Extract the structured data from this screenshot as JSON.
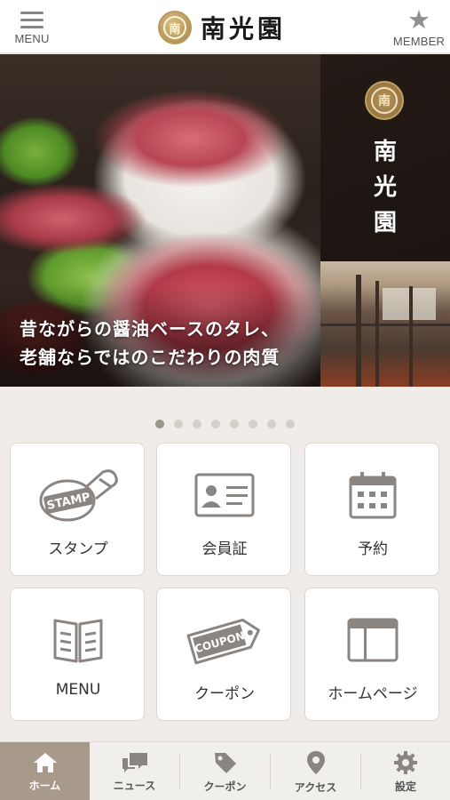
{
  "header": {
    "menu_label": "MENU",
    "member_label": "MEMBER",
    "brand_name": "南光園",
    "brand_mark_char": "南"
  },
  "hero": {
    "caption_line1": "昔ながらの醤油ベースのタレ、",
    "caption_line2": "老舗ならではのこだわりの肉質",
    "side_title": "南光園",
    "side_mark_char": "南"
  },
  "pager": {
    "count": 8,
    "active_index": 0
  },
  "tiles": [
    {
      "label": "スタンプ",
      "icon": "stamp-icon",
      "stamp_text": "STAMP"
    },
    {
      "label": "会員証",
      "icon": "member-card-icon"
    },
    {
      "label": "予約",
      "icon": "calendar-icon"
    },
    {
      "label": "MENU",
      "icon": "menu-book-icon"
    },
    {
      "label": "クーポン",
      "icon": "coupon-icon",
      "coupon_text": "COUPON"
    },
    {
      "label": "ホームページ",
      "icon": "homepage-icon"
    }
  ],
  "bottom_nav": [
    {
      "label": "ホーム",
      "icon": "home-icon",
      "active": true
    },
    {
      "label": "ニュース",
      "icon": "news-icon",
      "active": false
    },
    {
      "label": "クーポン",
      "icon": "coupon-tag-icon",
      "active": false
    },
    {
      "label": "アクセス",
      "icon": "location-pin-icon",
      "active": false
    },
    {
      "label": "設定",
      "icon": "gear-icon",
      "active": false
    }
  ],
  "colors": {
    "background": "#efece9",
    "icon_gray": "#8a8580",
    "active_nav": "#a89a8a",
    "brand_gold": "#b8995a"
  }
}
